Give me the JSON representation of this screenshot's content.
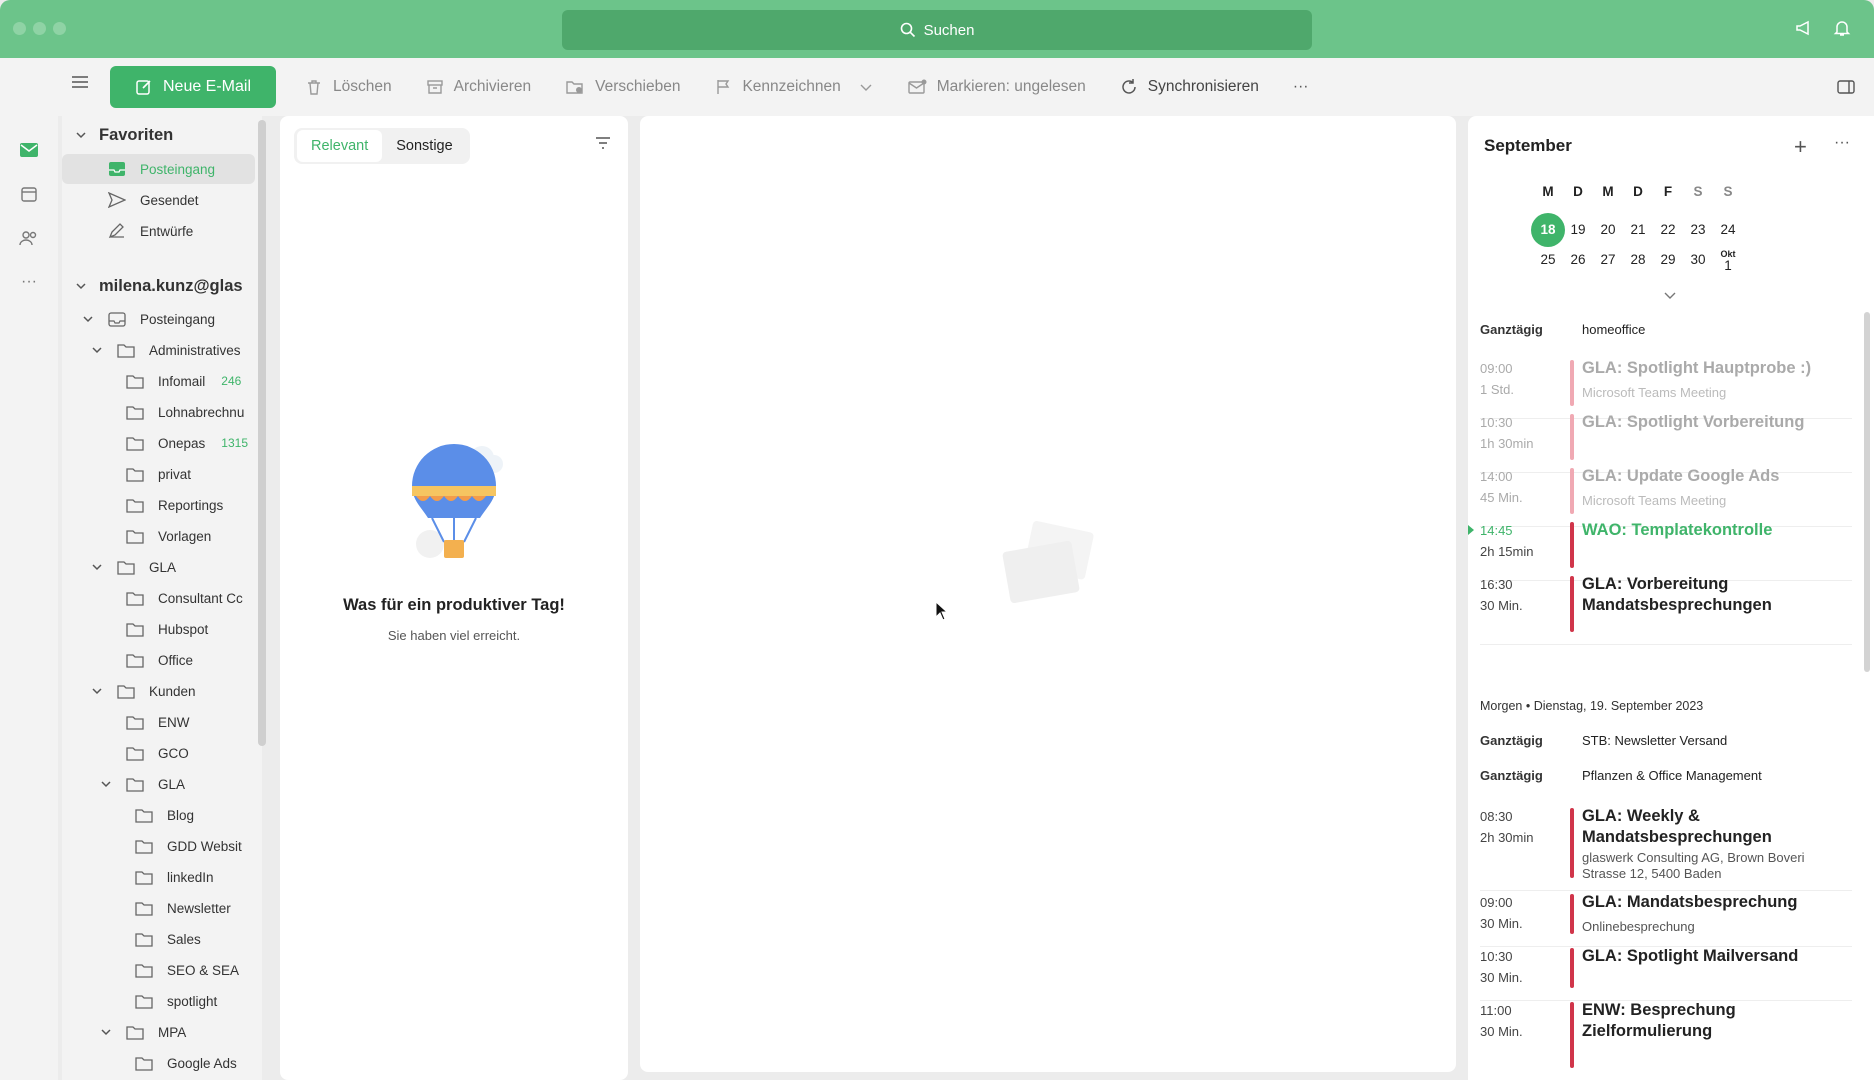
{
  "title_bar": {
    "search_label": "Suchen"
  },
  "toolbar": {
    "new_mail": "Neue E-Mail",
    "delete": "Löschen",
    "archive": "Archivieren",
    "move": "Verschieben",
    "flag": "Kennzeichnen",
    "mark_unread": "Markieren: ungelesen",
    "sync": "Synchronisieren",
    "more": "···"
  },
  "favorites": {
    "heading": "Favoriten",
    "items": [
      "Posteingang",
      "Gesendet",
      "Entwürfe"
    ]
  },
  "account": {
    "name": "milena.kunz@glas",
    "folders": {
      "inbox": "Posteingang",
      "administratives": "Administratives",
      "infomail": "Infomail",
      "infomail_count": "246",
      "lohn": "Lohnabrechnu",
      "onepas": "Onepas",
      "onepas_count": "1315",
      "privat": "privat",
      "reportings": "Reportings",
      "vorlagen": "Vorlagen",
      "gla": "GLA",
      "consultant": "Consultant Cc",
      "hubspot": "Hubspot",
      "office": "Office",
      "kunden": "Kunden",
      "enw": "ENW",
      "gco": "GCO",
      "kunden_gla": "GLA",
      "blog": "Blog",
      "gdd": "GDD Websit",
      "linkedin": "linkedIn",
      "newsletter": "Newsletter",
      "sales": "Sales",
      "seo": "SEO & SEA",
      "spotlight": "spotlight",
      "mpa": "MPA",
      "google_ads": "Google Ads"
    }
  },
  "message_list": {
    "tab_relevant": "Relevant",
    "tab_other": "Sonstige",
    "empty_title": "Was für ein produktiver Tag!",
    "empty_subtitle": "Sie haben viel erreicht."
  },
  "calendar": {
    "month": "September",
    "weekdays": [
      "M",
      "D",
      "M",
      "D",
      "F",
      "S",
      "S"
    ],
    "week1": [
      "18",
      "19",
      "20",
      "21",
      "22",
      "23",
      "24"
    ],
    "week2": [
      "25",
      "26",
      "27",
      "28",
      "29",
      "30",
      "1"
    ],
    "oct_label": "Okt",
    "today": "18",
    "allday_label": "Ganztägig",
    "today_allday": "homeoffice",
    "events_today": [
      {
        "time": "09:00",
        "duration": "1 Std.",
        "title": "GLA: Spotlight Hauptprobe :)",
        "sub": "Microsoft Teams Meeting"
      },
      {
        "time": "10:30",
        "duration": "1h 30min",
        "title": "GLA: Spotlight Vorbereitung",
        "sub": ""
      },
      {
        "time": "14:00",
        "duration": "45 Min.",
        "title": "GLA: Update Google Ads",
        "sub": "Microsoft Teams Meeting"
      },
      {
        "time": "14:45",
        "duration": "2h 15min",
        "title": "WAO: Templatekontrolle",
        "sub": ""
      },
      {
        "time": "16:30",
        "duration": "30 Min.",
        "title": "GLA: Vorbereitung Mandatsbesprechungen",
        "sub": ""
      }
    ],
    "tomorrow_header": "Morgen • Dienstag, 19. September 2023",
    "tomorrow_allday": [
      "STB: Newsletter Versand",
      "Pflanzen & Office Management"
    ],
    "events_tomorrow": [
      {
        "time": "08:30",
        "duration": "2h 30min",
        "title": "GLA: Weekly & Mandatsbesprechungen",
        "sub": "glaswerk Consulting AG, Brown Boveri Strasse 12, 5400 Baden"
      },
      {
        "time": "09:00",
        "duration": "30 Min.",
        "title": "GLA: Mandatsbesprechung",
        "sub": "Onlinebesprechung"
      },
      {
        "time": "10:30",
        "duration": "30 Min.",
        "title": "GLA: Spotlight Mailversand",
        "sub": ""
      },
      {
        "time": "11:00",
        "duration": "30 Min.",
        "title": "ENW: Besprechung Zielformulierung",
        "sub": ""
      }
    ]
  },
  "colors": {
    "accent": "#3fb46a",
    "titlebar": "#6cc48a",
    "event_bar": "#d0354a",
    "event_bar_past": "#f0a9b3"
  }
}
